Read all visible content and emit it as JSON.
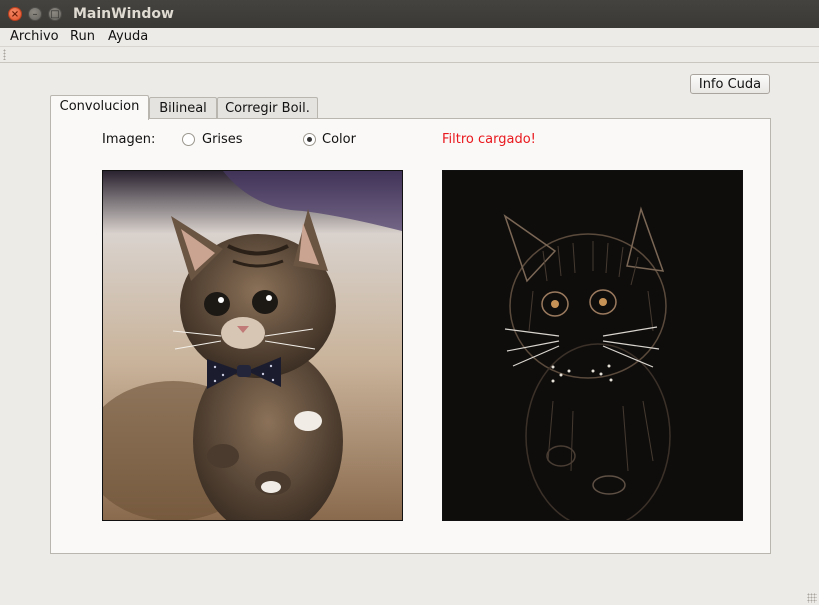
{
  "window": {
    "title": "MainWindow",
    "controls": [
      "close-icon",
      "minimize-icon",
      "maximize-icon"
    ]
  },
  "menubar": {
    "items": [
      "Archivo",
      "Run",
      "Ayuda"
    ]
  },
  "toolbar": {
    "info_button_label": "Info Cuda"
  },
  "tabs": [
    {
      "label": "Convolucion",
      "active": true
    },
    {
      "label": "Bilineal",
      "active": false
    },
    {
      "label": "Corregir Boil.",
      "active": false
    }
  ],
  "convolucion": {
    "image_label": "Imagen:",
    "options": [
      {
        "label": "Grises",
        "checked": false
      },
      {
        "label": "Color",
        "checked": true
      }
    ],
    "status": "Filtro cargado!",
    "status_color": "#e8171d",
    "original_image": "kitten-photo",
    "filtered_image": "kitten-edge-filtered"
  }
}
